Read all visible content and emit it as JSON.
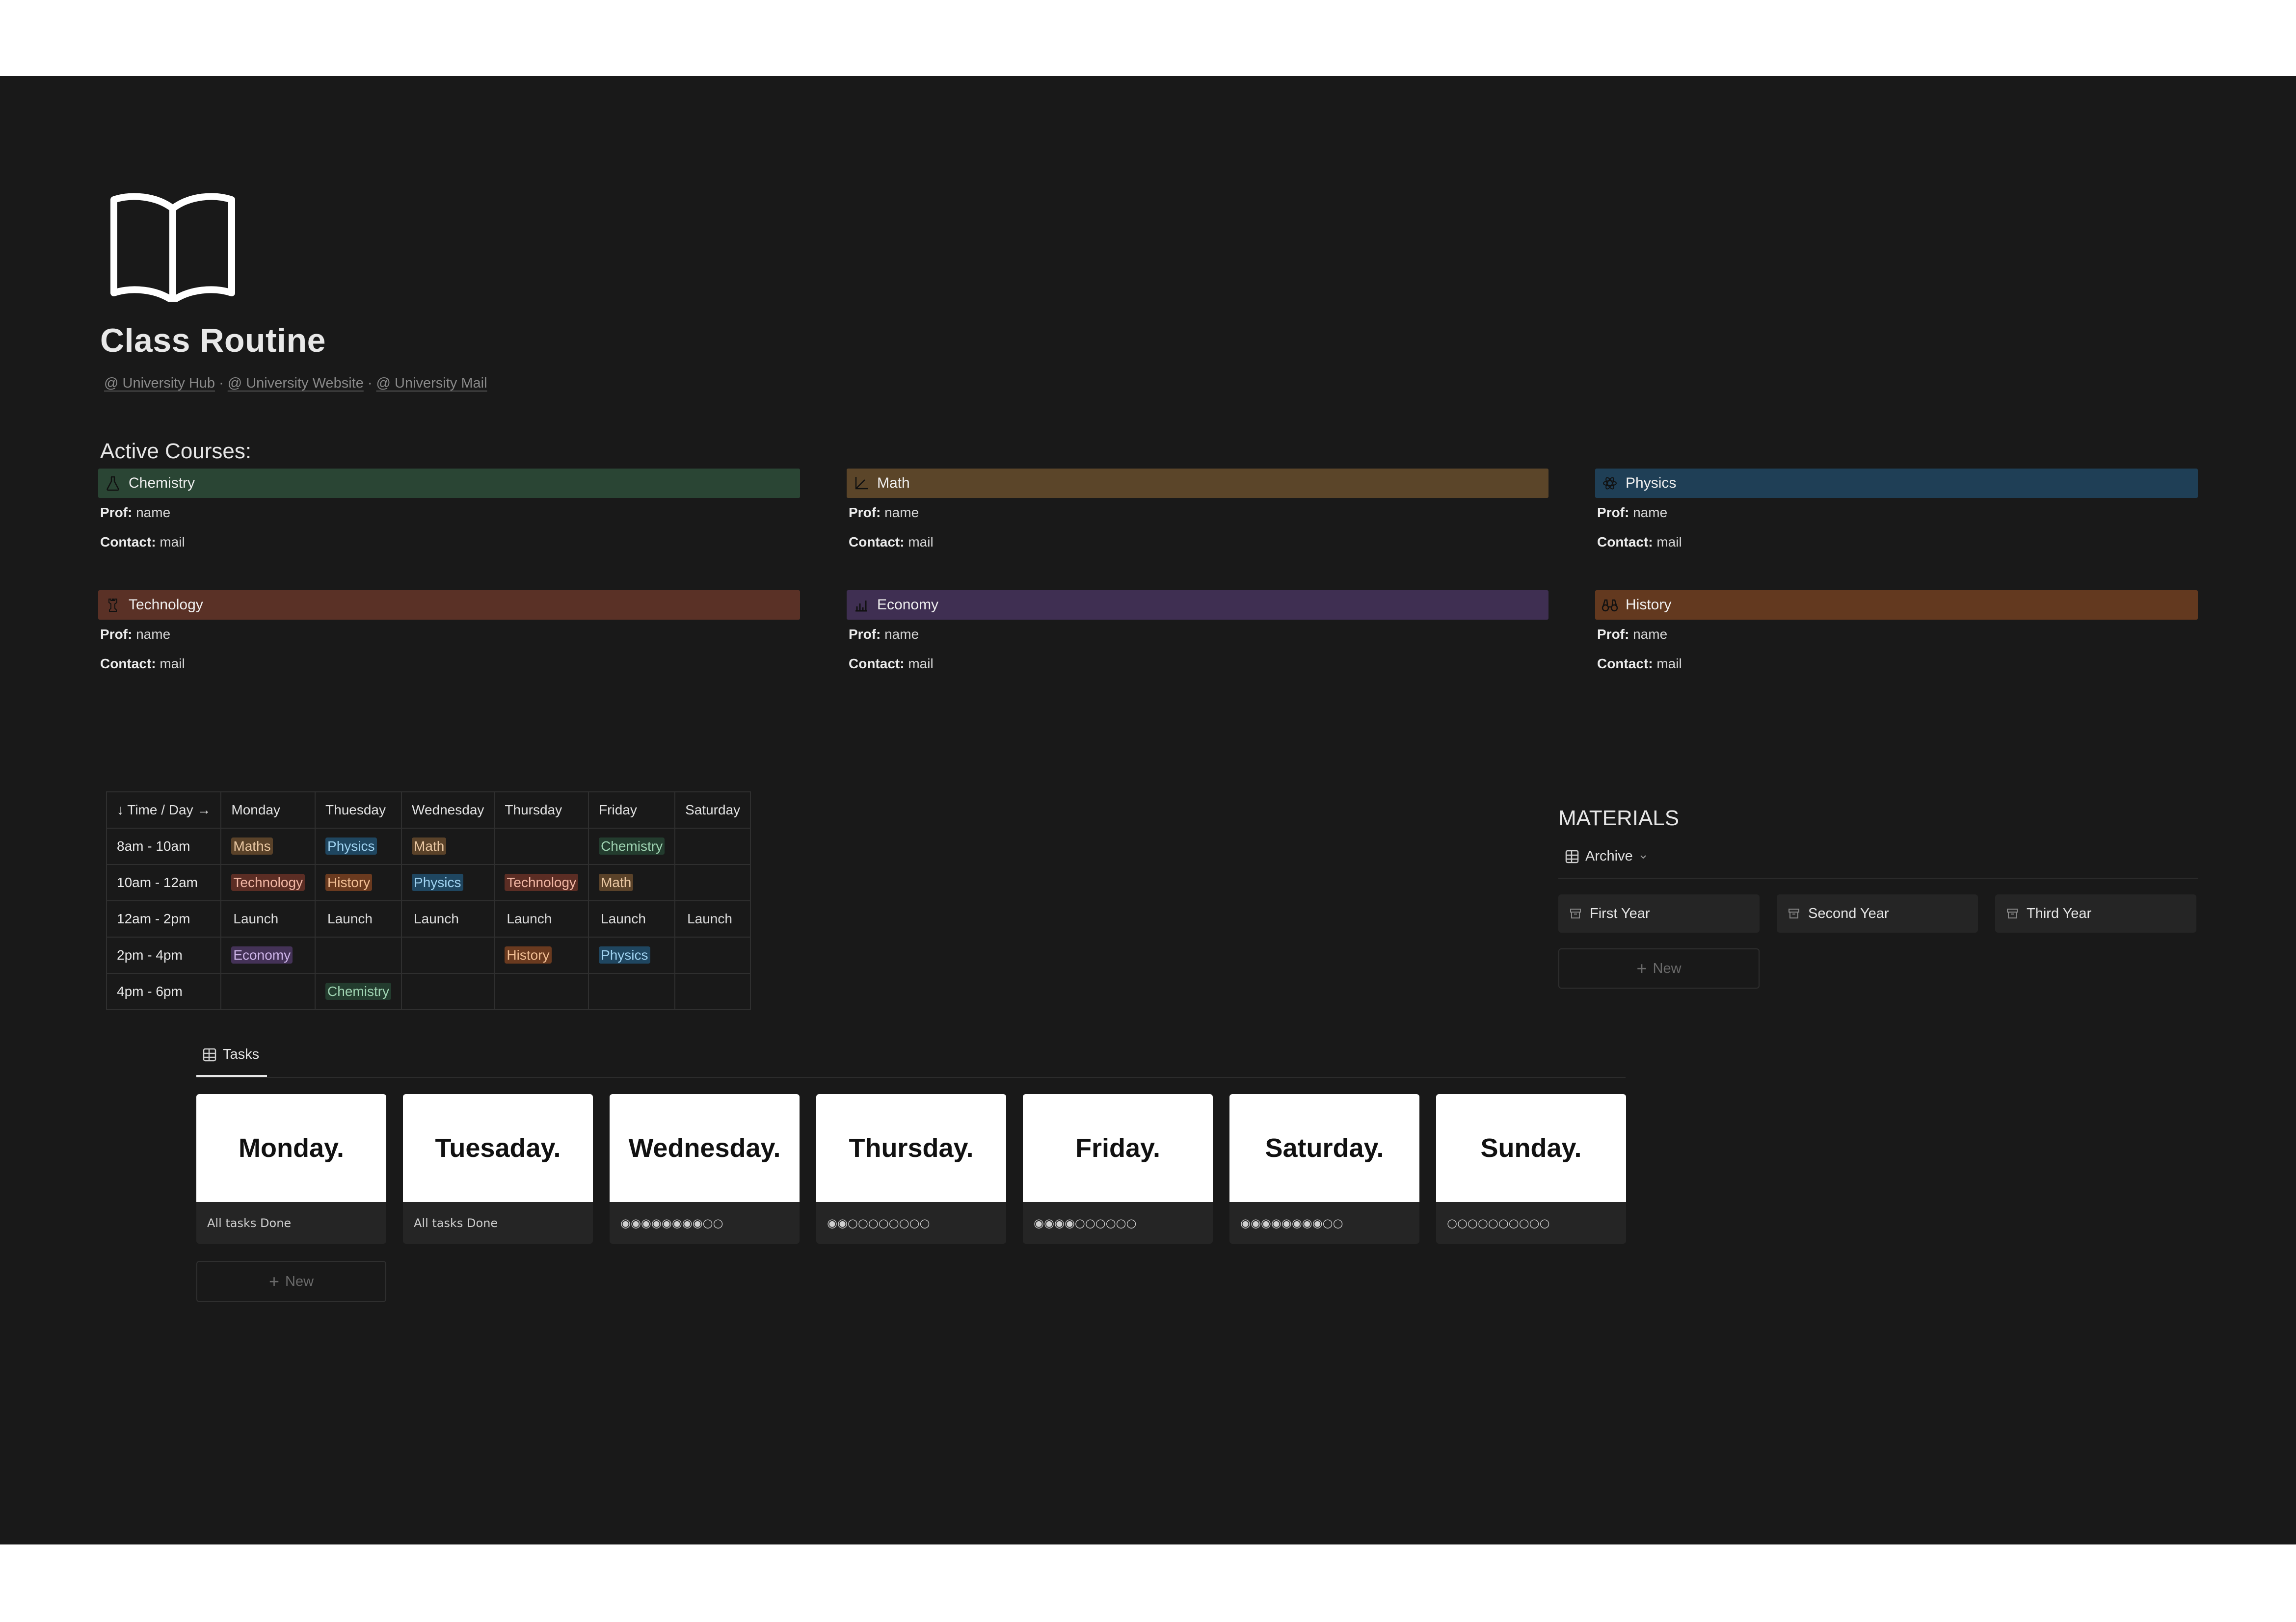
{
  "page": {
    "icon": "book-icon",
    "title": "Class Routine",
    "links": [
      "@ University Hub",
      "@ University Website",
      "@ University Mail"
    ],
    "link_separator": "·"
  },
  "courses": {
    "section_title": "Active Courses:",
    "prof_label": "Prof:",
    "contact_label": "Contact:",
    "items": [
      {
        "name": "Chemistry",
        "icon": "flask-icon",
        "color": "#2a4534",
        "prof": "name",
        "contact": "mail"
      },
      {
        "name": "Math",
        "icon": "axes-icon",
        "color": "#5b4529",
        "prof": "name",
        "contact": "mail"
      },
      {
        "name": "Physics",
        "icon": "atom-icon",
        "color": "#1f3f56",
        "prof": "name",
        "contact": "mail"
      },
      {
        "name": "Technology",
        "icon": "chess-rook-icon",
        "color": "#5a3126",
        "prof": "name",
        "contact": "mail"
      },
      {
        "name": "Economy",
        "icon": "chart-icon",
        "color": "#3f2f52",
        "prof": "name",
        "contact": "mail"
      },
      {
        "name": "History",
        "icon": "binoculars-icon",
        "color": "#63391f",
        "prof": "name",
        "contact": "mail"
      }
    ]
  },
  "schedule": {
    "headers": [
      "↓ Time / Day →",
      "Monday",
      "Thuesday",
      "Wednesday",
      "Thursday",
      "Friday",
      "Saturday"
    ],
    "rows": [
      {
        "time": "8am - 10am",
        "cells": [
          {
            "text": "Maths",
            "color": "brown"
          },
          {
            "text": "Physics",
            "color": "blue"
          },
          {
            "text": "Math",
            "color": "brown"
          },
          {
            "text": "",
            "color": ""
          },
          {
            "text": "Chemistry",
            "color": "green"
          },
          {
            "text": "",
            "color": ""
          }
        ]
      },
      {
        "time": "10am - 12am",
        "cells": [
          {
            "text": "Technology",
            "color": "red"
          },
          {
            "text": "History",
            "color": "orange"
          },
          {
            "text": "Physics",
            "color": "blue"
          },
          {
            "text": "Technology",
            "color": "red"
          },
          {
            "text": "Math",
            "color": "brown"
          },
          {
            "text": "",
            "color": ""
          }
        ]
      },
      {
        "time": "12am - 2pm",
        "cells": [
          {
            "text": "Launch",
            "color": ""
          },
          {
            "text": "Launch",
            "color": ""
          },
          {
            "text": "Launch",
            "color": ""
          },
          {
            "text": "Launch",
            "color": ""
          },
          {
            "text": "Launch",
            "color": ""
          },
          {
            "text": "Launch",
            "color": ""
          }
        ]
      },
      {
        "time": "2pm - 4pm",
        "cells": [
          {
            "text": "Economy",
            "color": "purple"
          },
          {
            "text": "",
            "color": ""
          },
          {
            "text": "",
            "color": ""
          },
          {
            "text": "History",
            "color": "orange"
          },
          {
            "text": "Physics",
            "color": "blue"
          },
          {
            "text": "",
            "color": ""
          }
        ]
      },
      {
        "time": "4pm - 6pm",
        "cells": [
          {
            "text": "",
            "color": ""
          },
          {
            "text": "Chemistry",
            "color": "green"
          },
          {
            "text": "",
            "color": ""
          },
          {
            "text": "",
            "color": ""
          },
          {
            "text": "",
            "color": ""
          },
          {
            "text": "",
            "color": ""
          }
        ]
      }
    ]
  },
  "materials": {
    "title": "MATERIALS",
    "view_label": "Archive",
    "cards": [
      "First Year",
      "Second Year",
      "Third Year"
    ],
    "new_label": "New"
  },
  "tasks": {
    "tab_label": "Tasks",
    "new_label": "New",
    "days": [
      {
        "name": "Monday.",
        "status": "All tasks Done"
      },
      {
        "name": "Tuesaday.",
        "status": "All tasks Done"
      },
      {
        "name": "Wednesday.",
        "status": "◉◉◉◉◉◉◉◉○○"
      },
      {
        "name": "Thursday.",
        "status": "◉◉○○○○○○○○"
      },
      {
        "name": "Friday.",
        "status": "◉◉◉◉○○○○○○"
      },
      {
        "name": "Saturday.",
        "status": "◉◉◉◉◉◉◉◉○○"
      },
      {
        "name": "Sunday.",
        "status": "○○○○○○○○○○"
      }
    ]
  }
}
